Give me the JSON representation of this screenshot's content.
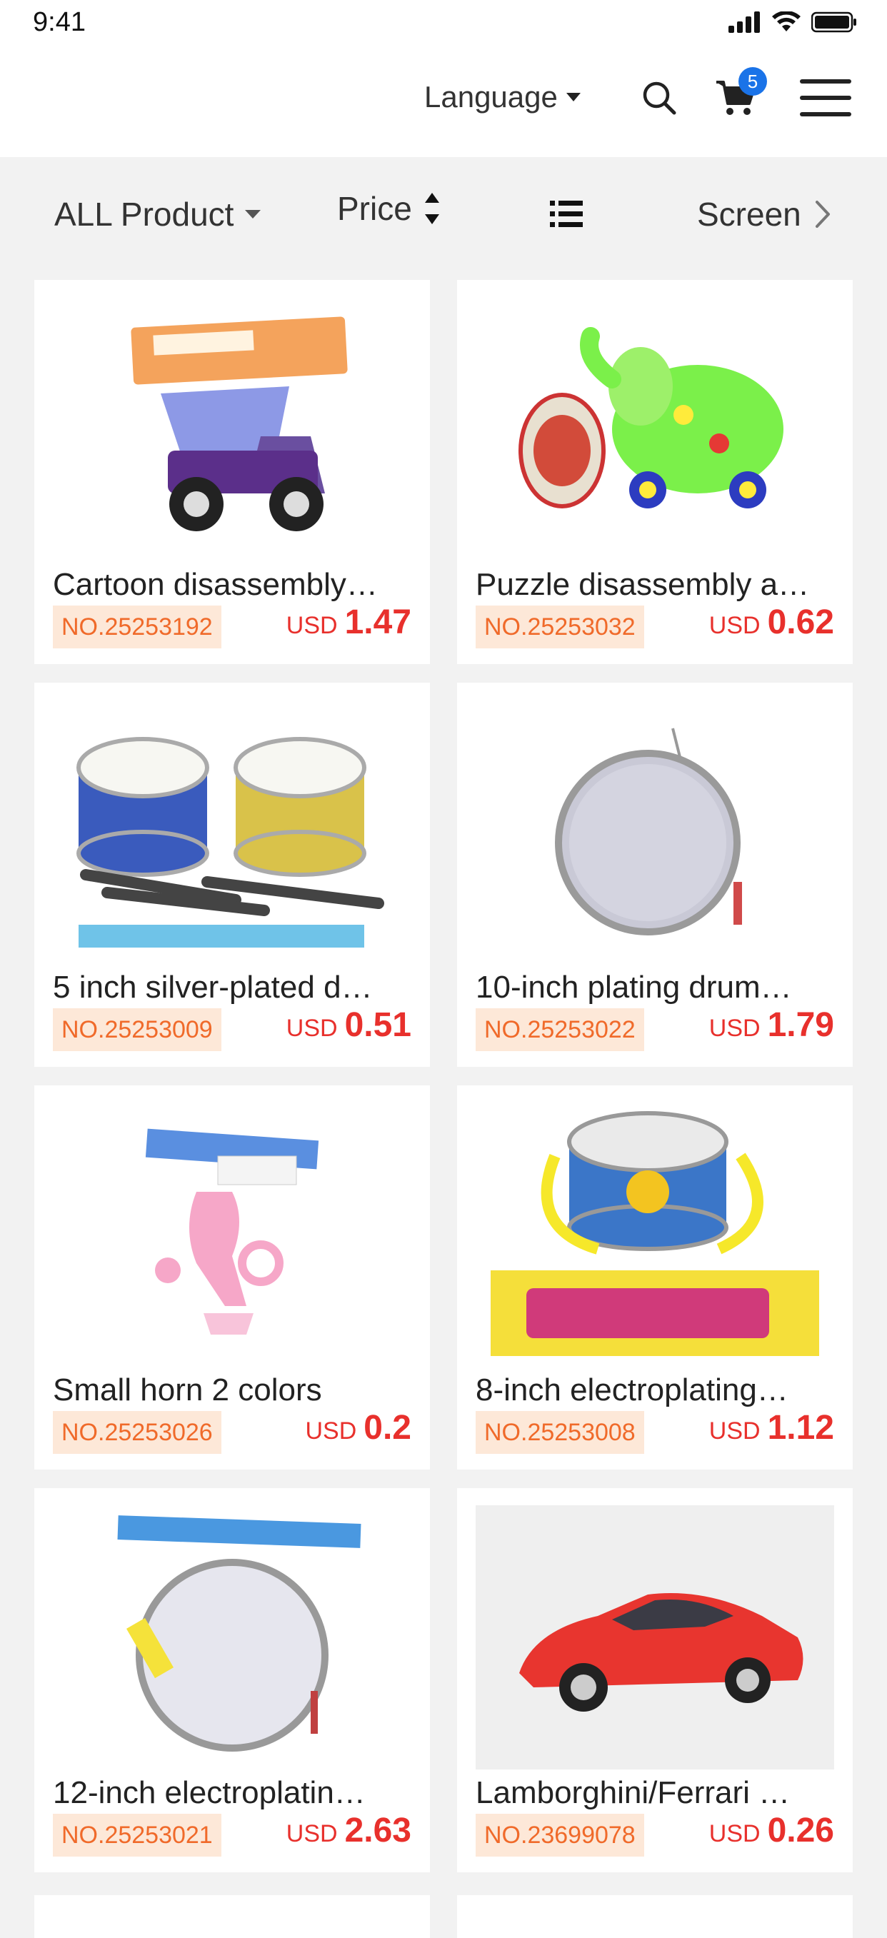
{
  "status": {
    "time": "9:41"
  },
  "header": {
    "language_label": "Language",
    "cart_count": "5"
  },
  "filters": {
    "all_product": "ALL Product",
    "price": "Price",
    "screen": "Screen"
  },
  "products": [
    {
      "title": "Cartoon disassembly…",
      "no": "NO.25253192",
      "currency": "USD",
      "price": "1.47"
    },
    {
      "title": "Puzzle disassembly a…",
      "no": "NO.25253032",
      "currency": "USD",
      "price": "0.62"
    },
    {
      "title": "5 inch silver-plated d…",
      "no": "NO.25253009",
      "currency": "USD",
      "price": "0.51"
    },
    {
      "title": "10-inch plating drum…",
      "no": "NO.25253022",
      "currency": "USD",
      "price": "1.79"
    },
    {
      "title": "Small horn 2 colors",
      "no": "NO.25253026",
      "currency": "USD",
      "price": "0.2"
    },
    {
      "title": "8-inch electroplating…",
      "no": "NO.25253008",
      "currency": "USD",
      "price": "1.12"
    },
    {
      "title": "12-inch electroplatin…",
      "no": "NO.25253021",
      "currency": "USD",
      "price": "2.63"
    },
    {
      "title": "Lamborghini/Ferrari …",
      "no": "NO.23699078",
      "currency": "USD",
      "price": "0.26"
    }
  ],
  "colors": {
    "accent_orange": "#f06a2a",
    "price_red": "#e8302c",
    "badge_blue": "#1a73e8"
  }
}
